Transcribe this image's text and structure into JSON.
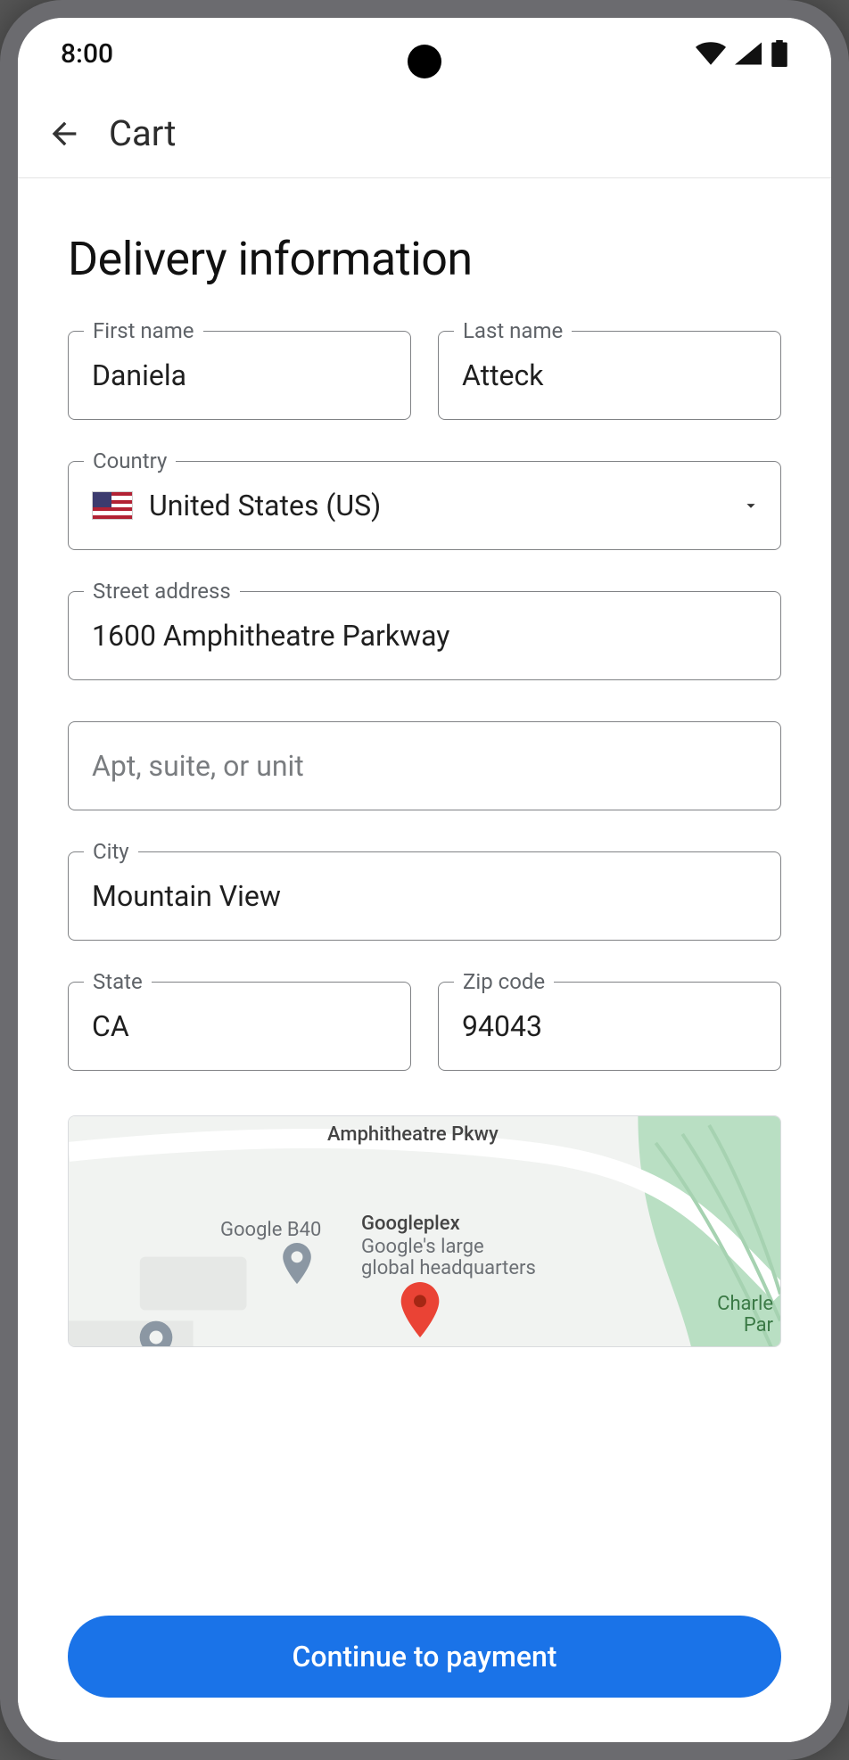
{
  "status_bar": {
    "time": "8:00"
  },
  "app_bar": {
    "title": "Cart"
  },
  "page": {
    "title": "Delivery information"
  },
  "form": {
    "first_name": {
      "label": "First name",
      "value": "Daniela"
    },
    "last_name": {
      "label": "Last name",
      "value": "Atteck"
    },
    "country": {
      "label": "Country",
      "value": "United States (US)"
    },
    "street": {
      "label": "Street address",
      "value": "1600 Amphitheatre Parkway"
    },
    "apt": {
      "placeholder": "Apt, suite, or unit",
      "value": ""
    },
    "city": {
      "label": "City",
      "value": "Mountain View"
    },
    "state": {
      "label": "State",
      "value": "CA"
    },
    "zip": {
      "label": "Zip code",
      "value": "94043"
    }
  },
  "map": {
    "road_label": "Amphitheatre Pkwy",
    "poi_b40": "Google B40",
    "poi_plex_name": "Googleplex",
    "poi_plex_desc1": "Google's large",
    "poi_plex_desc2": "global headquarters",
    "poi_charle": "Charle",
    "poi_par": "Par"
  },
  "actions": {
    "continue": "Continue to payment"
  }
}
